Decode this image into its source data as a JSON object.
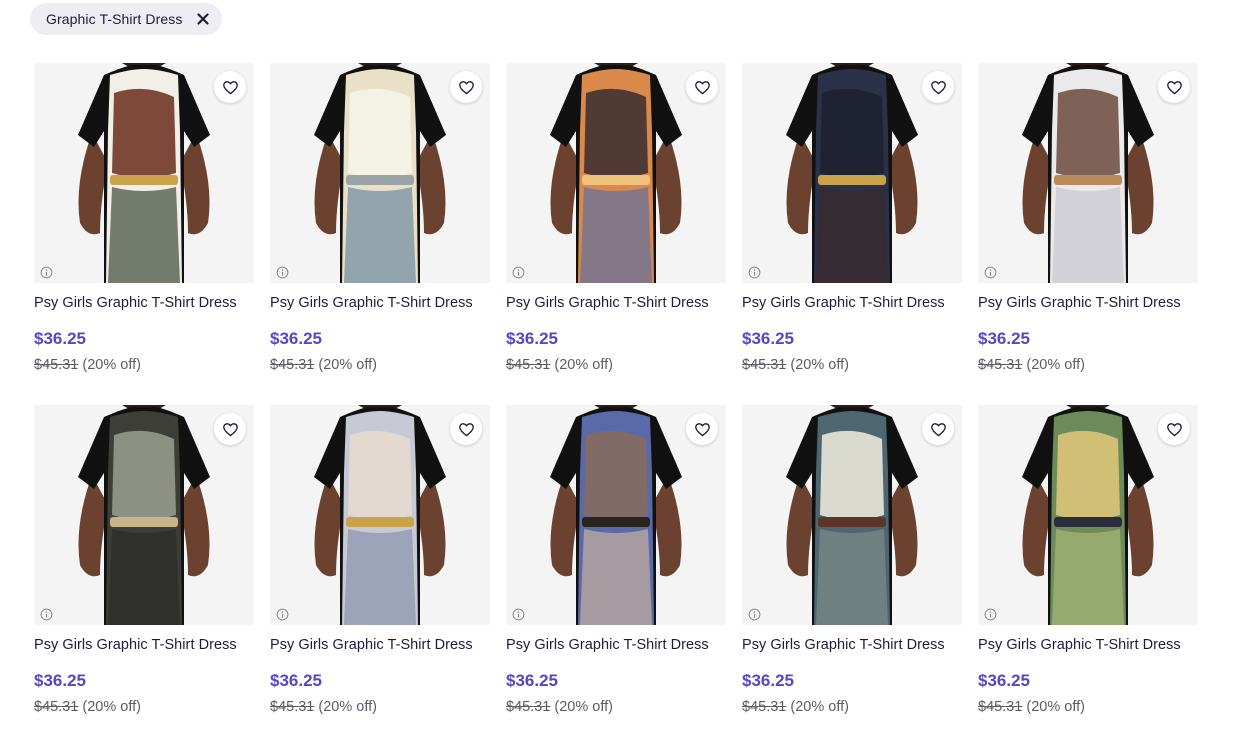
{
  "filter": {
    "chip_label": "Graphic T-Shirt Dress",
    "close_icon": "close-icon"
  },
  "colors": {
    "price": "#5a44c8",
    "chip_bg": "#eeeef2",
    "thumb_bg": "#f3f3f3"
  },
  "products": [
    {
      "title": "Psy Girls Graphic T-Shirt Dress",
      "price": "$36.25",
      "original_price": "$45.31",
      "discount": "(20% off)",
      "palette": [
        "#f1efe8",
        "#6a2a1c",
        "#c9a24a",
        "#3c4a3a"
      ]
    },
    {
      "title": "Psy Girls Graphic T-Shirt Dress",
      "price": "$36.25",
      "original_price": "$45.31",
      "discount": "(20% off)",
      "palette": [
        "#e9e0c8",
        "#f6f3ea",
        "#9aa3a8",
        "#6f8aa0"
      ]
    },
    {
      "title": "Psy Girls Graphic T-Shirt Dress",
      "price": "$36.25",
      "original_price": "$45.31",
      "discount": "(20% off)",
      "palette": [
        "#d98a4a",
        "#3a2c30",
        "#f1c27a",
        "#5f6fa3"
      ]
    },
    {
      "title": "Psy Girls Graphic T-Shirt Dress",
      "price": "$36.25",
      "original_price": "$45.31",
      "discount": "(20% off)",
      "palette": [
        "#2a3148",
        "#1d2030",
        "#c9a24a",
        "#3a2a2a"
      ]
    },
    {
      "title": "Psy Girls Graphic T-Shirt Dress",
      "price": "$36.25",
      "original_price": "$45.31",
      "discount": "(20% off)",
      "palette": [
        "#ebe9ea",
        "#6b4a3e",
        "#b98a5a",
        "#c8c8d0"
      ]
    },
    {
      "title": "Psy Girls Graphic T-Shirt Dress",
      "price": "$36.25",
      "original_price": "$45.31",
      "discount": "(20% off)",
      "palette": [
        "#3e3e38",
        "#9aa090",
        "#c9b48a",
        "#2b2b28"
      ]
    },
    {
      "title": "Psy Girls Graphic T-Shirt Dress",
      "price": "$36.25",
      "original_price": "$45.31",
      "discount": "(20% off)",
      "palette": [
        "#c7cad4",
        "#e9dccf",
        "#c9a24a",
        "#8c93ad"
      ]
    },
    {
      "title": "Psy Girls Graphic T-Shirt Dress",
      "price": "$36.25",
      "original_price": "$45.31",
      "discount": "(20% off)",
      "palette": [
        "#5a6aa8",
        "#8a6a5a",
        "#2a2420",
        "#c8b0a0"
      ]
    },
    {
      "title": "Psy Girls Graphic T-Shirt Dress",
      "price": "$36.25",
      "original_price": "$45.31",
      "discount": "(20% off)",
      "palette": [
        "#4e6670",
        "#f3eee0",
        "#5a3528",
        "#7d8c88"
      ]
    },
    {
      "title": "Psy Girls Graphic T-Shirt Dress",
      "price": "$36.25",
      "original_price": "$45.31",
      "discount": "(20% off)",
      "palette": [
        "#6c8a5a",
        "#e2c87a",
        "#2a2d3a",
        "#a8b878"
      ]
    }
  ],
  "icons": {
    "favorite": "heart-outline-icon",
    "info": "info-icon"
  }
}
